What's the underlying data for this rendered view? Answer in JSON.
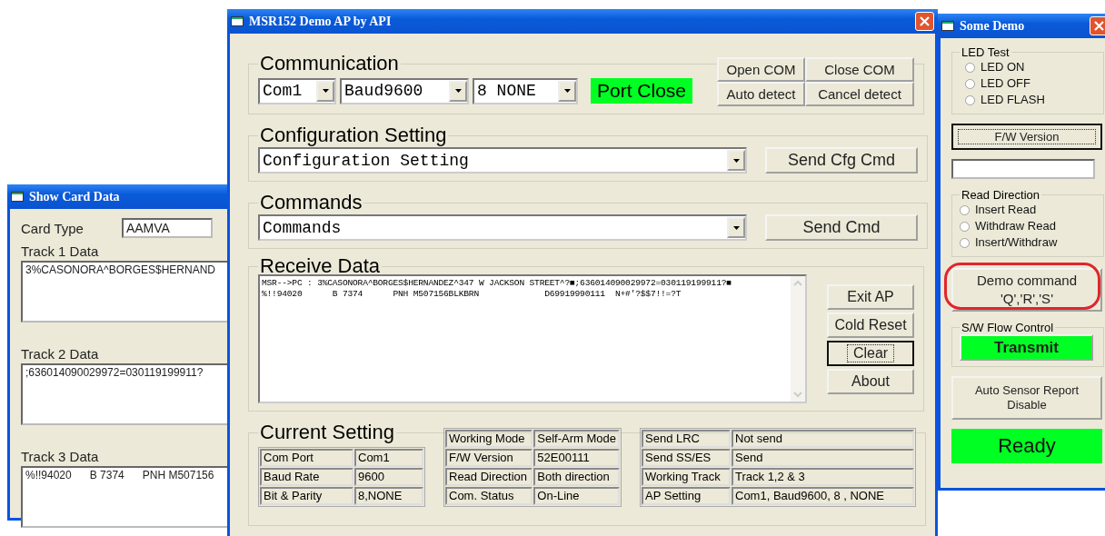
{
  "card_window": {
    "title": "Show Card Data",
    "card_type_label": "Card Type",
    "card_type_value": "AAMVA",
    "tracks": [
      {
        "label": "Track 1 Data",
        "value": "3%CASONORA^BORGES$HERNAND"
      },
      {
        "label": "Track 2 Data",
        "value": ";636014090029972=030119199911?"
      },
      {
        "label": "Track 3 Data",
        "value": "%!!94020      B 7374      PNH M507156"
      }
    ]
  },
  "main_window": {
    "title": "MSR152 Demo AP by API",
    "communication": {
      "legend": "Communication",
      "selects": [
        "Com1",
        "Baud9600",
        "8 NONE"
      ],
      "port_status": "Port Close",
      "buttons": [
        "Open COM",
        "Close COM",
        "Auto detect",
        "Cancel detect"
      ]
    },
    "configuration": {
      "legend": "Configuration Setting",
      "select": "Configuration Setting",
      "button": "Send Cfg Cmd"
    },
    "commands": {
      "legend": "Commands",
      "select": "Commands",
      "button": "Send Cmd"
    },
    "receive": {
      "legend": "Receive Data",
      "lines": [
        "MSR-->PC : 3%CASONORA^BORGES$HERNANDEZ^347 W JACKSON STREET^?■;636014090029972=030119199911?■",
        "%!!94020      B 7374      PNH M507156BLKBRN             D69919990111  N+#'?$$7!!=?T"
      ],
      "buttons": [
        {
          "label": "Exit AP",
          "focused": false
        },
        {
          "label": "Cold Reset",
          "focused": false
        },
        {
          "label": "Clear",
          "focused": true
        },
        {
          "label": "About",
          "focused": false
        }
      ]
    },
    "current_setting": {
      "legend": "Current Setting",
      "tables": [
        [
          {
            "label": "Com Port",
            "value": "Com1"
          },
          {
            "label": "Baud Rate",
            "value": "9600"
          },
          {
            "label": "Bit & Parity",
            "value": "8,NONE"
          }
        ],
        [
          {
            "label": "Working Mode",
            "value": "Self-Arm Mode"
          },
          {
            "label": "F/W Version",
            "value": "52E00111"
          },
          {
            "label": "Read Direction",
            "value": "Both direction"
          },
          {
            "label": "Com. Status",
            "value": "On-Line"
          }
        ],
        [
          {
            "label": "Send LRC",
            "value": "Not send"
          },
          {
            "label": "Send SS/ES",
            "value": "Send"
          },
          {
            "label": "Working Track",
            "value": "Track 1,2 & 3"
          },
          {
            "label": "AP Setting",
            "value": "Com1, Baud9600, 8 , NONE"
          }
        ]
      ]
    }
  },
  "demo_window": {
    "title": "Some Demo",
    "led_test": {
      "legend": "LED Test",
      "options": [
        {
          "label": "LED ON",
          "selected": false
        },
        {
          "label": "LED OFF",
          "selected": false
        },
        {
          "label": "LED FLASH",
          "selected": false
        }
      ]
    },
    "fw_button": {
      "label": "F/W Version",
      "focused": true
    },
    "read_direction": {
      "legend": "Read Direction",
      "options": [
        {
          "label": "Insert Read",
          "selected": false
        },
        {
          "label": "Withdraw Read",
          "selected": false
        },
        {
          "label": "Insert/Withdraw",
          "selected": false
        }
      ]
    },
    "demo_command": {
      "label": "Demo command\n'Q','R','S'",
      "highlighted": true
    },
    "flow_control": {
      "legend": "S/W Flow Control",
      "button": "Transmit"
    },
    "sensor_button": "Auto Sensor Report\nDisable",
    "status": "Ready"
  }
}
